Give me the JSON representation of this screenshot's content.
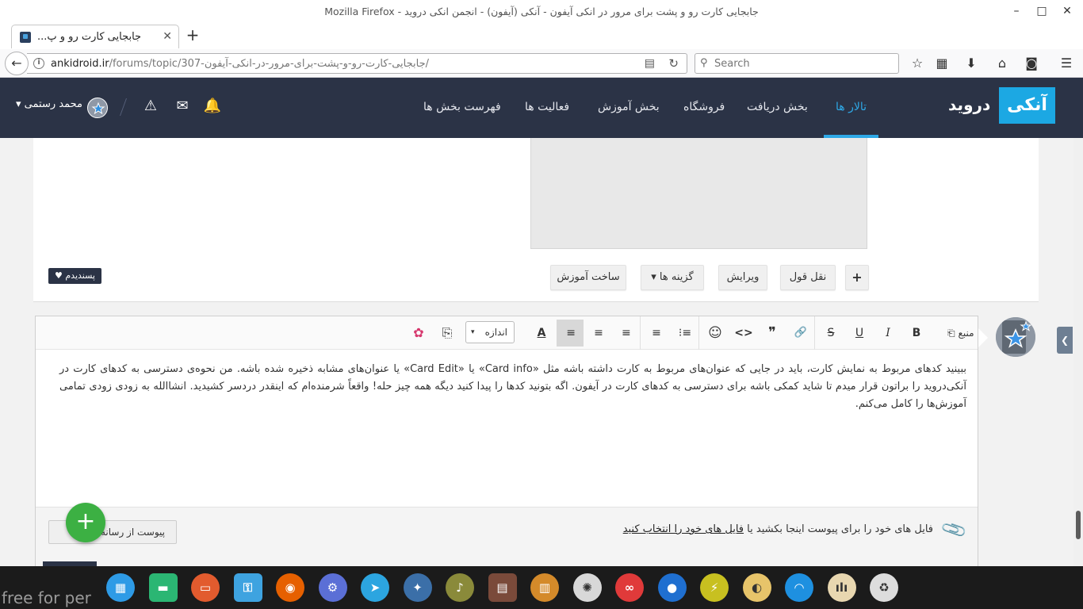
{
  "window": {
    "title": "جابجایی کارت رو و پشت برای مرور در انکی آیفون - آنکی (آیفون) - انجمن انکی درويد - Mozilla Firefox",
    "minimize_glyph": "–",
    "maximize_glyph": "□",
    "close_glyph": "✕"
  },
  "tabs": [
    {
      "title": "جابجایی کارت رو و پ...",
      "close_glyph": "✕"
    }
  ],
  "new_tab_glyph": "+",
  "navbar": {
    "back_glyph": "←",
    "info_glyph": "i",
    "url_host": "ankidroid.ir",
    "url_path": "/forums/topic/307-جابجایی-کارت-رو-و-پشت-برای-مرور-در-انکی-آیفون/",
    "reader_glyph": "▤",
    "reload_glyph": "↻",
    "search_glyph": "⚲",
    "search_placeholder": "Search",
    "toolbar_icons": [
      {
        "name": "bookmark-star-icon",
        "glyph": "☆"
      },
      {
        "name": "library-icon",
        "glyph": "▦"
      },
      {
        "name": "download-icon",
        "glyph": "⬇"
      },
      {
        "name": "home-icon",
        "glyph": "⌂"
      },
      {
        "name": "pocket-icon",
        "glyph": "◙"
      },
      {
        "name": "menu-icon",
        "glyph": "☰"
      }
    ]
  },
  "site": {
    "logo_box": "آنکی",
    "logo_rest": "درويد",
    "nav": [
      {
        "label": "تالار ها",
        "active": true
      },
      {
        "label": "بخش دریافت",
        "active": false
      },
      {
        "label": "فروشگاه",
        "active": false
      },
      {
        "label": "بخش آموزش",
        "active": false
      },
      {
        "label": "فعالیت ها",
        "active": false
      },
      {
        "label": "فهرست بخش ها",
        "active": false
      }
    ],
    "user_name": "محمد رستمی",
    "user_caret": "▾",
    "icons": {
      "bell": "🔔",
      "mail": "✉",
      "warning": "⚠"
    }
  },
  "post": {
    "buttons": {
      "plus": "+",
      "quote": "نقل قول",
      "edit": "ویرایش",
      "options": "گزینه ها",
      "options_caret": "▾",
      "create_tutorial": "ساخت آموزش"
    },
    "like_badge": "♥ پسندیدم"
  },
  "editor": {
    "toolbar": {
      "source": "منبع",
      "source_glyph": "⎗",
      "bold": "B",
      "italic": "I",
      "underline": "U",
      "strike": "S",
      "link": "🔗",
      "quote": "❞",
      "code": "<>",
      "emoji": "☺",
      "bulleted_list": "⁝≡",
      "numbered_list": "≡",
      "align_left": "≡",
      "align_center": "≡",
      "align_right": "≡",
      "text_color": "A",
      "size_label": "اندازه",
      "size_caret": "▾",
      "paste_plain": "⎘",
      "spellcheck": "✿"
    },
    "body_text": "ببینید کدهای مربوط به نمایش کارت، باید در جایی که عنوان‌های مربوط به کارت داشته باشه مثل «Card info» یا «Card Edit» یا عنوان‌های مشابه ذخیره شده باشه. من نحوه‌ی دسترسی به کدهای کارت در آنکی‌درويد را براتون قرار میدم تا شاید کمکی باشه برای دسترسی به کدهای کارت در آیفون. اگه بتونید کدها را پیدا کنید دیگه همه چیز حله! واقعاً شرمنده‌ام که اینقدر دردسر کشیدید. انشاالله به زودی زودی تمامی آموزش‌ها را کامل می‌کنم.",
    "attach_prefix": "فایل های خود را برای پیوست اینجا بکشید یا",
    "attach_link": "فایل های خود را انتخاب کنید",
    "attach_glyph": "📎",
    "media_button": "پیوست از رسانه ها"
  },
  "fab_glyph": "+",
  "side_tab_glyph": "❮",
  "taskbar": {
    "watermark": "free for per",
    "apps": [
      {
        "name": "app-grid-icon",
        "glyph": "▦",
        "color": "#2e9be6"
      },
      {
        "name": "terminal-icon",
        "glyph": "▬",
        "color": "#2bb673"
      },
      {
        "name": "video-camera-icon",
        "glyph": "▭",
        "color": "#e25b2e"
      },
      {
        "name": "keyring-icon",
        "glyph": "⚿",
        "color": "#3ea3e0"
      },
      {
        "name": "firefox-icon",
        "glyph": "◉",
        "color": "#e66000"
      },
      {
        "name": "settings-document-icon",
        "glyph": "⚙",
        "color": "#5b6fd6"
      },
      {
        "name": "telegram-icon",
        "glyph": "➤",
        "color": "#2ca5e0"
      },
      {
        "name": "fish-icon",
        "glyph": "✦",
        "color": "#3b6fa8"
      },
      {
        "name": "music-icon",
        "glyph": "♪",
        "color": "#8a8a3a"
      },
      {
        "name": "document-viewer-icon",
        "glyph": "▤",
        "color": "#7a4a3a"
      },
      {
        "name": "archive-icon",
        "glyph": "▥",
        "color": "#d48a2a"
      },
      {
        "name": "system-settings-icon",
        "glyph": "✺",
        "color": "#d8d8d8"
      },
      {
        "name": "flickr-icon",
        "glyph": "∞",
        "color": "#e03a3a"
      },
      {
        "name": "screen-recorder-icon",
        "glyph": "●",
        "color": "#1f6fd0"
      },
      {
        "name": "power-icon",
        "glyph": "⚡",
        "color": "#c8c020"
      },
      {
        "name": "disk-icon",
        "glyph": "◐",
        "color": "#e7c46a"
      },
      {
        "name": "wifi-icon",
        "glyph": "◠",
        "color": "#1e90e0"
      },
      {
        "name": "clock-icon",
        "glyph": "ılı",
        "color": "#e8d7b0"
      },
      {
        "name": "recycle-bin-icon",
        "glyph": "♻",
        "color": "#dddddd"
      }
    ]
  }
}
